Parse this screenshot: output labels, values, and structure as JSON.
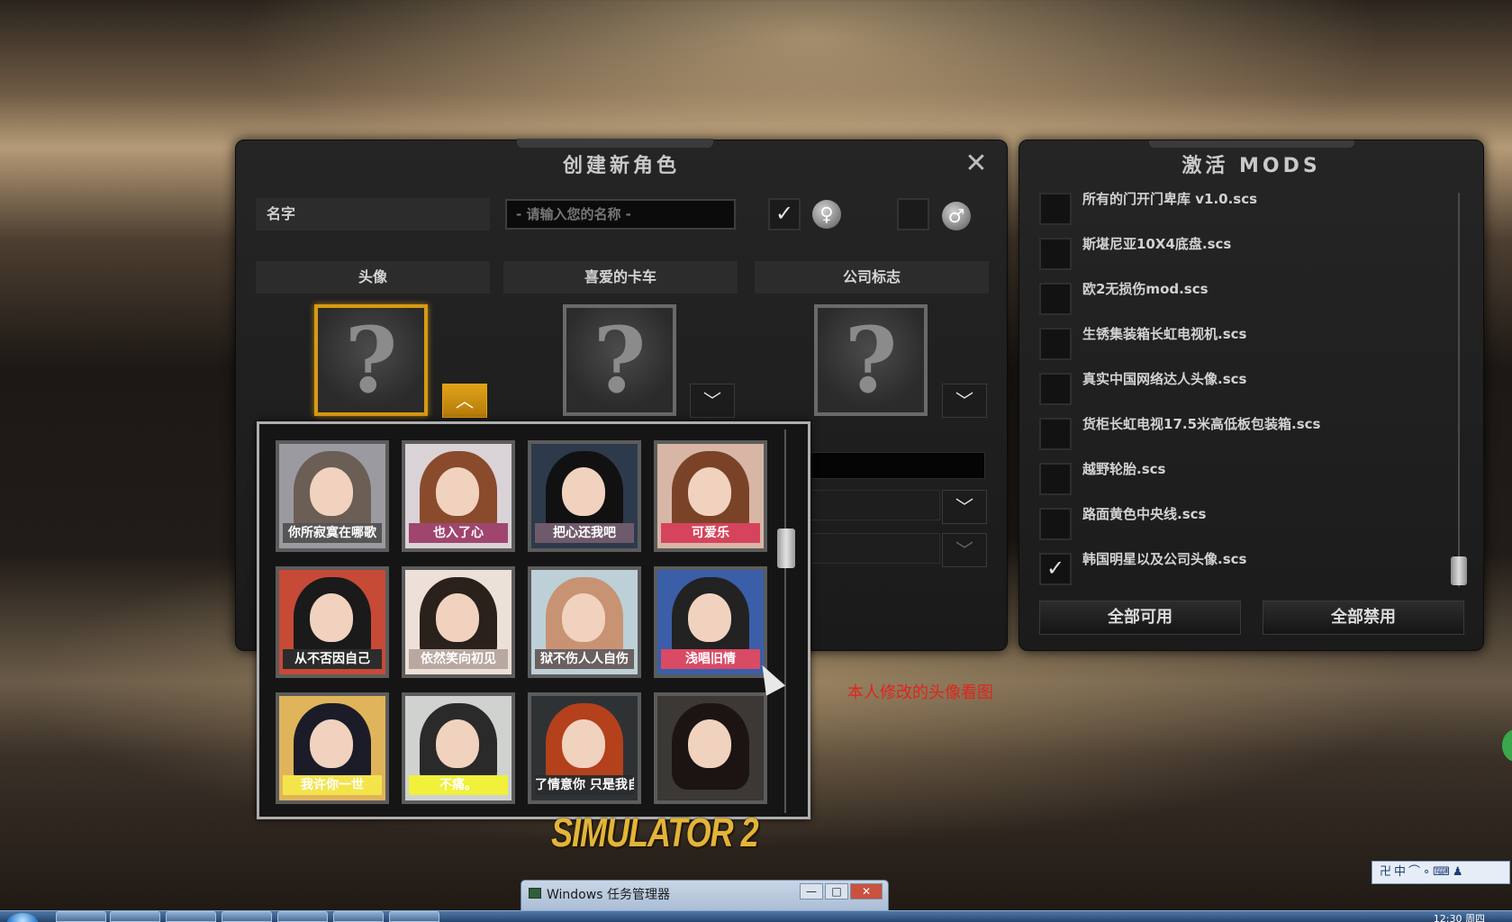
{
  "create_panel": {
    "title": "创建新角色",
    "close_glyph": "✕",
    "name_label": "名字",
    "name_input_placeholder": "- 请输入您的名称 -",
    "gender_check_glyph": "✓",
    "female_glyph": "♀",
    "male_glyph": "♂",
    "columns": [
      "头像",
      "喜爱的卡车",
      "公司标志"
    ],
    "question_glyph": "?",
    "arrow_up": "︿",
    "arrow_down": "﹀"
  },
  "avatar_captions": [
    "你所寂寞在哪歌",
    "也入了心",
    "把心还我吧",
    "可爱乐",
    "从不否因自己",
    "依然笑向初见",
    "狱不伤人人自伤",
    "浅唱旧情",
    "我许你一世",
    "不痛。",
    "了情意你 只是我自作",
    ""
  ],
  "avatar_colors": [
    {
      "hair": "#6b5e55",
      "bg": "#9a9aa0",
      "cap": "#555555"
    },
    {
      "hair": "#8a4b2c",
      "bg": "#d9d3d7",
      "cap": "#a0466e"
    },
    {
      "hair": "#111111",
      "bg": "#2d3a4c",
      "cap": "#6f5a6b"
    },
    {
      "hair": "#7a4328",
      "bg": "#d7b6a5",
      "cap": "#d5445c"
    },
    {
      "hair": "#1a1a1a",
      "bg": "#c64a36",
      "cap": "#2c2c2c"
    },
    {
      "hair": "#2b211c",
      "bg": "#ece0d8",
      "cap": "#b9a8a0"
    },
    {
      "hair": "#c89372",
      "bg": "#bdd0d8",
      "cap": "#6a6060"
    },
    {
      "hair": "#222222",
      "bg": "#3b5ea8",
      "cap": "#d94a64"
    },
    {
      "hair": "#1c1c28",
      "bg": "#e0b45a",
      "cap": "#f3e44c"
    },
    {
      "hair": "#2a2a2a",
      "bg": "#cfd2cf",
      "cap": "#f1f03a"
    },
    {
      "hair": "#b4401c",
      "bg": "#2f3235",
      "cap": "#2c2c2c"
    },
    {
      "hair": "#1b1412",
      "bg": "#3b3836",
      "cap": "#3b3836"
    }
  ],
  "mods_panel": {
    "title": "激活 MODS",
    "items": [
      {
        "name": "所有的门开门卑库 v1.0.scs",
        "checked": false
      },
      {
        "name": "斯堪尼亚10X4底盘.scs",
        "checked": false
      },
      {
        "name": "欧2无损伤mod.scs",
        "checked": false
      },
      {
        "name": "生锈集装箱长虹电视机.scs",
        "checked": false
      },
      {
        "name": "真实中国网络达人头像.scs",
        "checked": false
      },
      {
        "name": "货柜长虹电视17.5米高低板包装箱.scs",
        "checked": false
      },
      {
        "name": "越野轮胎.scs",
        "checked": false
      },
      {
        "name": "路面黄色中央线.scs",
        "checked": false
      },
      {
        "name": "韩国明星以及公司头像.scs",
        "checked": true
      }
    ],
    "enable_all": "全部可用",
    "disable_all": "全部禁用",
    "check_glyph": "✓"
  },
  "annotation": "本人修改的头像看图",
  "game_logo": "SIMULATOR 2",
  "ime_bar": "卍中⌒∘⌨♟",
  "taskmgr": {
    "title": "Windows 任务管理器",
    "minimize": "—",
    "maximize": "□",
    "close": "✕"
  },
  "taskbar": {
    "clock": "12:30 周四"
  }
}
